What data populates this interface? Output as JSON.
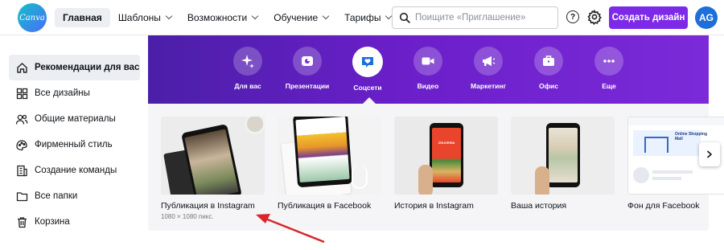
{
  "brand": {
    "logo_text": "Canva",
    "accent": "#7d2ae8"
  },
  "nav": {
    "items": [
      {
        "label": "Главная",
        "active": true,
        "dropdown": false
      },
      {
        "label": "Шаблоны",
        "active": false,
        "dropdown": true
      },
      {
        "label": "Возможности",
        "active": false,
        "dropdown": true
      },
      {
        "label": "Обучение",
        "active": false,
        "dropdown": true
      },
      {
        "label": "Тарифы",
        "active": false,
        "dropdown": true
      }
    ]
  },
  "search": {
    "placeholder": "Поищите «Приглашение»",
    "value": ""
  },
  "header": {
    "help_label": "?",
    "create_label": "Создать дизайн",
    "avatar_initials": "AG"
  },
  "sidebar": {
    "items": [
      {
        "label": "Рекомендации для вас",
        "icon": "home-icon",
        "active": true
      },
      {
        "label": "Все дизайны",
        "icon": "grid-icon",
        "active": false
      },
      {
        "label": "Общие материалы",
        "icon": "people-icon",
        "active": false
      },
      {
        "label": "Фирменный стиль",
        "icon": "brand-kit-icon",
        "active": false
      },
      {
        "label": "Создание команды",
        "icon": "building-icon",
        "active": false
      },
      {
        "label": "Все папки",
        "icon": "folder-icon",
        "active": false
      },
      {
        "label": "Корзина",
        "icon": "trash-icon",
        "active": false
      }
    ]
  },
  "categories": {
    "items": [
      {
        "label": "Для вас",
        "icon": "sparkle-icon"
      },
      {
        "label": "Презентации",
        "icon": "presentation-icon"
      },
      {
        "label": "Соцсети",
        "icon": "heart-chat-icon",
        "active": true
      },
      {
        "label": "Видео",
        "icon": "video-camera-icon"
      },
      {
        "label": "Маркетинг",
        "icon": "megaphone-icon"
      },
      {
        "label": "Офис",
        "icon": "briefcase-icon"
      },
      {
        "label": "Еще",
        "icon": "more-icon"
      }
    ]
  },
  "cards": {
    "items": [
      {
        "title": "Публикация в Instagram",
        "subtitle": "1080 × 1080 пикс."
      },
      {
        "title": "Публикация в Facebook",
        "subtitle": ""
      },
      {
        "title": "История в Instagram",
        "subtitle": "",
        "thumb_text": "ZRUVERNI"
      },
      {
        "title": "Ваша история",
        "subtitle": ""
      },
      {
        "title": "Фон для Facebook",
        "subtitle": "",
        "thumb_text": "Online Shopping Mall"
      }
    ]
  },
  "annotation": {
    "arrow_color": "#d9262b"
  }
}
